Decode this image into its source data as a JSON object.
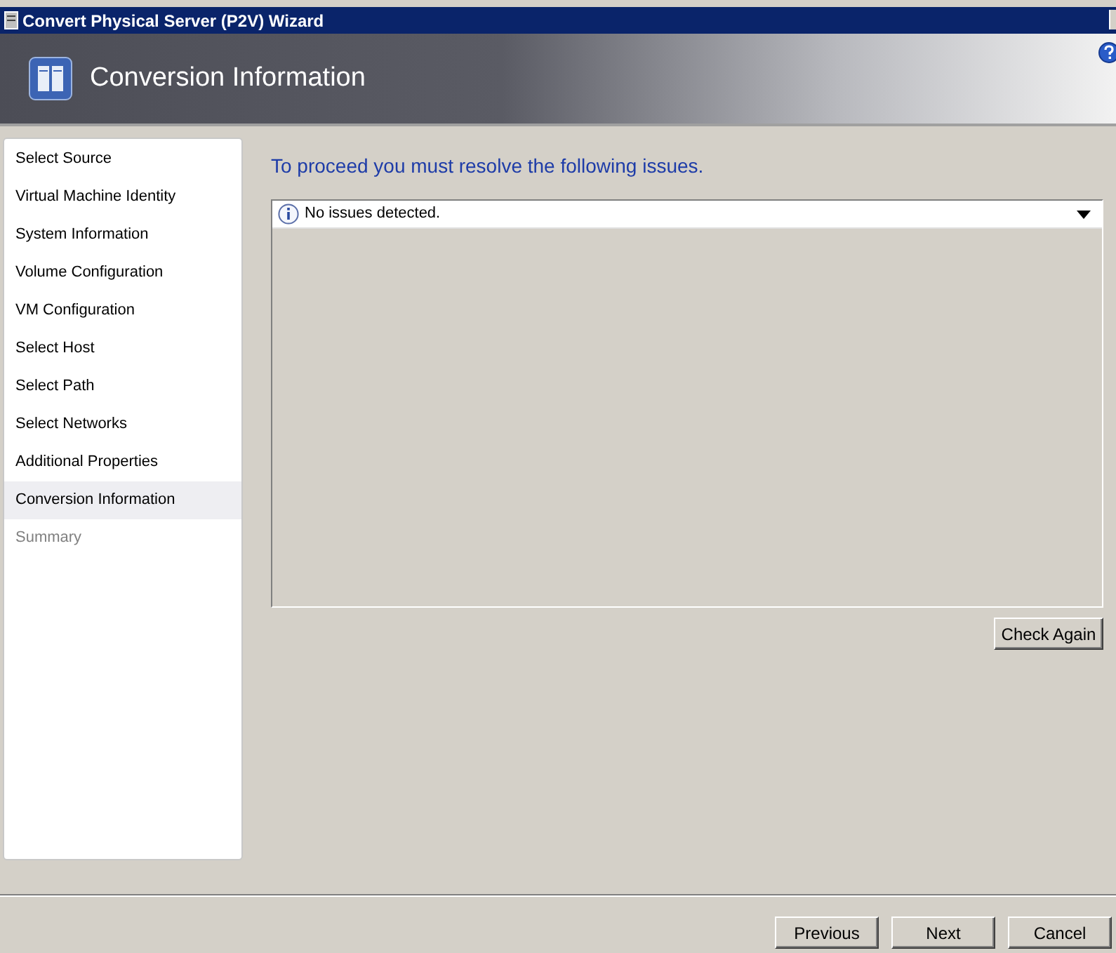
{
  "window": {
    "title": "Convert Physical Server (P2V) Wizard"
  },
  "header": {
    "title": "Conversion Information"
  },
  "sidebar": {
    "items": [
      {
        "label": "Select Source",
        "selected": false,
        "disabled": false
      },
      {
        "label": "Virtual Machine Identity",
        "selected": false,
        "disabled": false
      },
      {
        "label": "System Information",
        "selected": false,
        "disabled": false
      },
      {
        "label": "Volume Configuration",
        "selected": false,
        "disabled": false
      },
      {
        "label": "VM Configuration",
        "selected": false,
        "disabled": false
      },
      {
        "label": "Select Host",
        "selected": false,
        "disabled": false
      },
      {
        "label": "Select Path",
        "selected": false,
        "disabled": false
      },
      {
        "label": "Select Networks",
        "selected": false,
        "disabled": false
      },
      {
        "label": "Additional Properties",
        "selected": false,
        "disabled": false
      },
      {
        "label": "Conversion Information",
        "selected": true,
        "disabled": false
      },
      {
        "label": "Summary",
        "selected": false,
        "disabled": true
      }
    ]
  },
  "content": {
    "heading": "To proceed you must resolve the following issues.",
    "issues": {
      "message": "No issues detected.",
      "expanded": false
    },
    "check_button": "Check Again"
  },
  "buttons": [
    "Previous",
    "Next",
    "Cancel"
  ]
}
